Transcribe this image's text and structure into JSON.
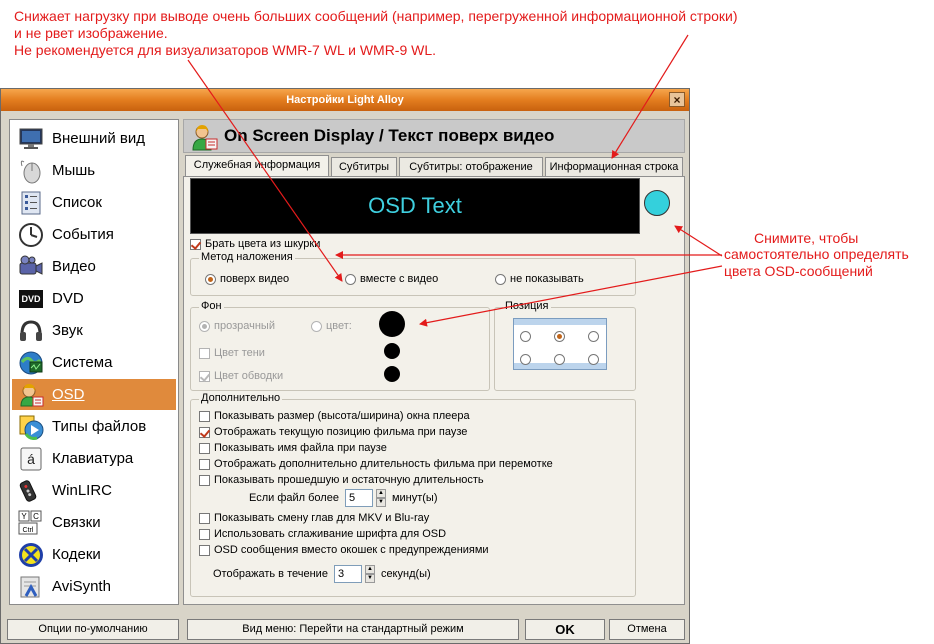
{
  "annotations": {
    "top_line1": "Снижает нагрузку при выводе очень больших сообщений (например, перегруженной информационной строки)",
    "top_line2": "и не рвет изображение.",
    "top_line3": "Не рекомендуется для визуализаторов WMR-7 WL и WMR-9 WL.",
    "right_line1": "Снимите, чтобы",
    "right_line2": "самостоятельно определять",
    "right_line3": "цвета OSD-сообщений",
    "color": "#e31b1b"
  },
  "window": {
    "title": "Настройки Light Alloy",
    "close_label": "×"
  },
  "sidebar": {
    "items": [
      {
        "label": "Внешний вид",
        "icon": "monitor-icon"
      },
      {
        "label": "Мышь",
        "icon": "mouse-icon"
      },
      {
        "label": "Список",
        "icon": "list-icon"
      },
      {
        "label": "События",
        "icon": "clock-icon"
      },
      {
        "label": "Видео",
        "icon": "camera-icon"
      },
      {
        "label": "DVD",
        "icon": "dvd-icon"
      },
      {
        "label": "Звук",
        "icon": "headphones-icon"
      },
      {
        "label": "Система",
        "icon": "system-icon"
      },
      {
        "label": "OSD",
        "icon": "osd-icon",
        "selected": true
      },
      {
        "label": "Типы файлов",
        "icon": "filetypes-icon"
      },
      {
        "label": "Клавиатура",
        "icon": "keyboard-icon"
      },
      {
        "label": "WinLIRC",
        "icon": "remote-icon"
      },
      {
        "label": "Связки",
        "icon": "hotkeys-icon"
      },
      {
        "label": "Кодеки",
        "icon": "codecs-icon"
      },
      {
        "label": "AviSynth",
        "icon": "avisynth-icon"
      }
    ]
  },
  "header": {
    "title": "On Screen Display / Текст поверх видео"
  },
  "tabs": [
    {
      "label": "Служебная информация",
      "active": true
    },
    {
      "label": "Субтитры"
    },
    {
      "label": "Субтитры: отображение"
    },
    {
      "label": "Информационная строка"
    }
  ],
  "preview": {
    "text": "OSD Text",
    "text_color": "#3fd0e0",
    "color_button": "#34d0dc"
  },
  "skin_colors": {
    "label": "Брать цвета из шкурки",
    "checked": true
  },
  "overlay": {
    "label": "Метод наложения",
    "options": [
      "поверх видео",
      "вместе с видео",
      "не показывать"
    ],
    "selected": 0
  },
  "background": {
    "label": "Фон",
    "transparent": "прозрачный",
    "color": "цвет:",
    "shadow": "Цвет тени",
    "outline": "Цвет обводки"
  },
  "position": {
    "label": "Позиция",
    "selected": 1
  },
  "extra": {
    "label": "Дополнительно",
    "show_size": "Показывать размер (высота/ширина) окна плеера",
    "show_pos_pause": "Отображать текущую позицию фильма при паузе",
    "show_filename": "Показывать имя файла при паузе",
    "show_duration": "Отображать дополнительно длительность фильма при перемотке",
    "show_elapsed": "Показывать прошедшую и остаточную длительность",
    "if_file_label": "Если файл более",
    "if_file_value": "5",
    "if_file_unit": "минут(ы)",
    "show_chapters": "Показывать смену глав для MKV и Blu-ray",
    "antialias": "Использовать сглаживание шрифта для OSD",
    "osd_instead": "OSD сообщения вместо окошек с предупреждениями",
    "duration_label": "Отображать в течение",
    "duration_value": "3",
    "duration_unit": "секунд(ы)"
  },
  "buttons": {
    "defaults": "Опции по-умолчанию",
    "menu_view": "Вид меню: Перейти на стандартный режим",
    "ok": "OK",
    "cancel": "Отмена"
  }
}
